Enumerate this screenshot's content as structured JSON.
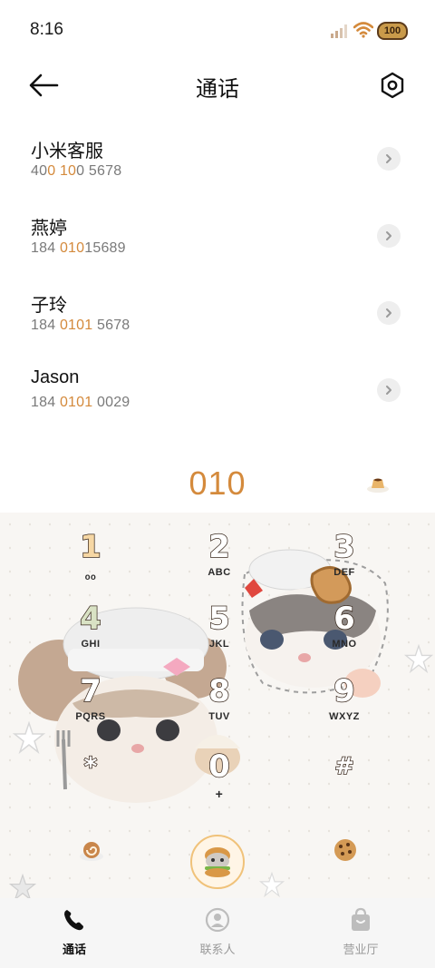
{
  "status_bar": {
    "time": "8:16",
    "battery_level": "100",
    "icons": [
      "signal-icon",
      "wifi-icon",
      "battery-icon"
    ]
  },
  "header": {
    "title": "通话",
    "back_icon": "arrow-left-icon",
    "settings_icon": "settings-icon"
  },
  "contacts": [
    {
      "name": "小米客服",
      "number_parts": [
        "40",
        "0 10",
        "0 5678"
      ]
    },
    {
      "name": "燕婷",
      "number_parts": [
        "184 ",
        "010",
        "15689"
      ]
    },
    {
      "name": "子玲",
      "number_parts": [
        "184 ",
        "0101",
        " 5678"
      ]
    },
    {
      "name": "Jason",
      "number_parts": [
        "184 ",
        "0101",
        " 0029"
      ]
    }
  ],
  "dialer": {
    "input_value": "010",
    "keys": [
      {
        "digit": "1",
        "letters": ""
      },
      {
        "digit": "2",
        "letters": "ABC"
      },
      {
        "digit": "3",
        "letters": "DEF"
      },
      {
        "digit": "4",
        "letters": "GHI"
      },
      {
        "digit": "5",
        "letters": "JKL"
      },
      {
        "digit": "6",
        "letters": "MNO"
      },
      {
        "digit": "7",
        "letters": "PQRS"
      },
      {
        "digit": "8",
        "letters": "TUV"
      },
      {
        "digit": "9",
        "letters": "WXYZ"
      },
      {
        "digit": "*",
        "letters": ""
      },
      {
        "digit": "0",
        "letters": "+"
      },
      {
        "digit": "#",
        "letters": ""
      }
    ]
  },
  "bottom_nav": [
    {
      "label": "通话",
      "icon": "phone-icon",
      "active": true
    },
    {
      "label": "联系人",
      "icon": "contact-icon",
      "active": false
    },
    {
      "label": "营业厅",
      "icon": "shop-bag-icon",
      "active": false
    }
  ],
  "colors": {
    "accent": "#d48a3c",
    "text_primary": "#111111",
    "text_secondary": "#7a7a7a",
    "nav_background": "#f6f6f6"
  }
}
